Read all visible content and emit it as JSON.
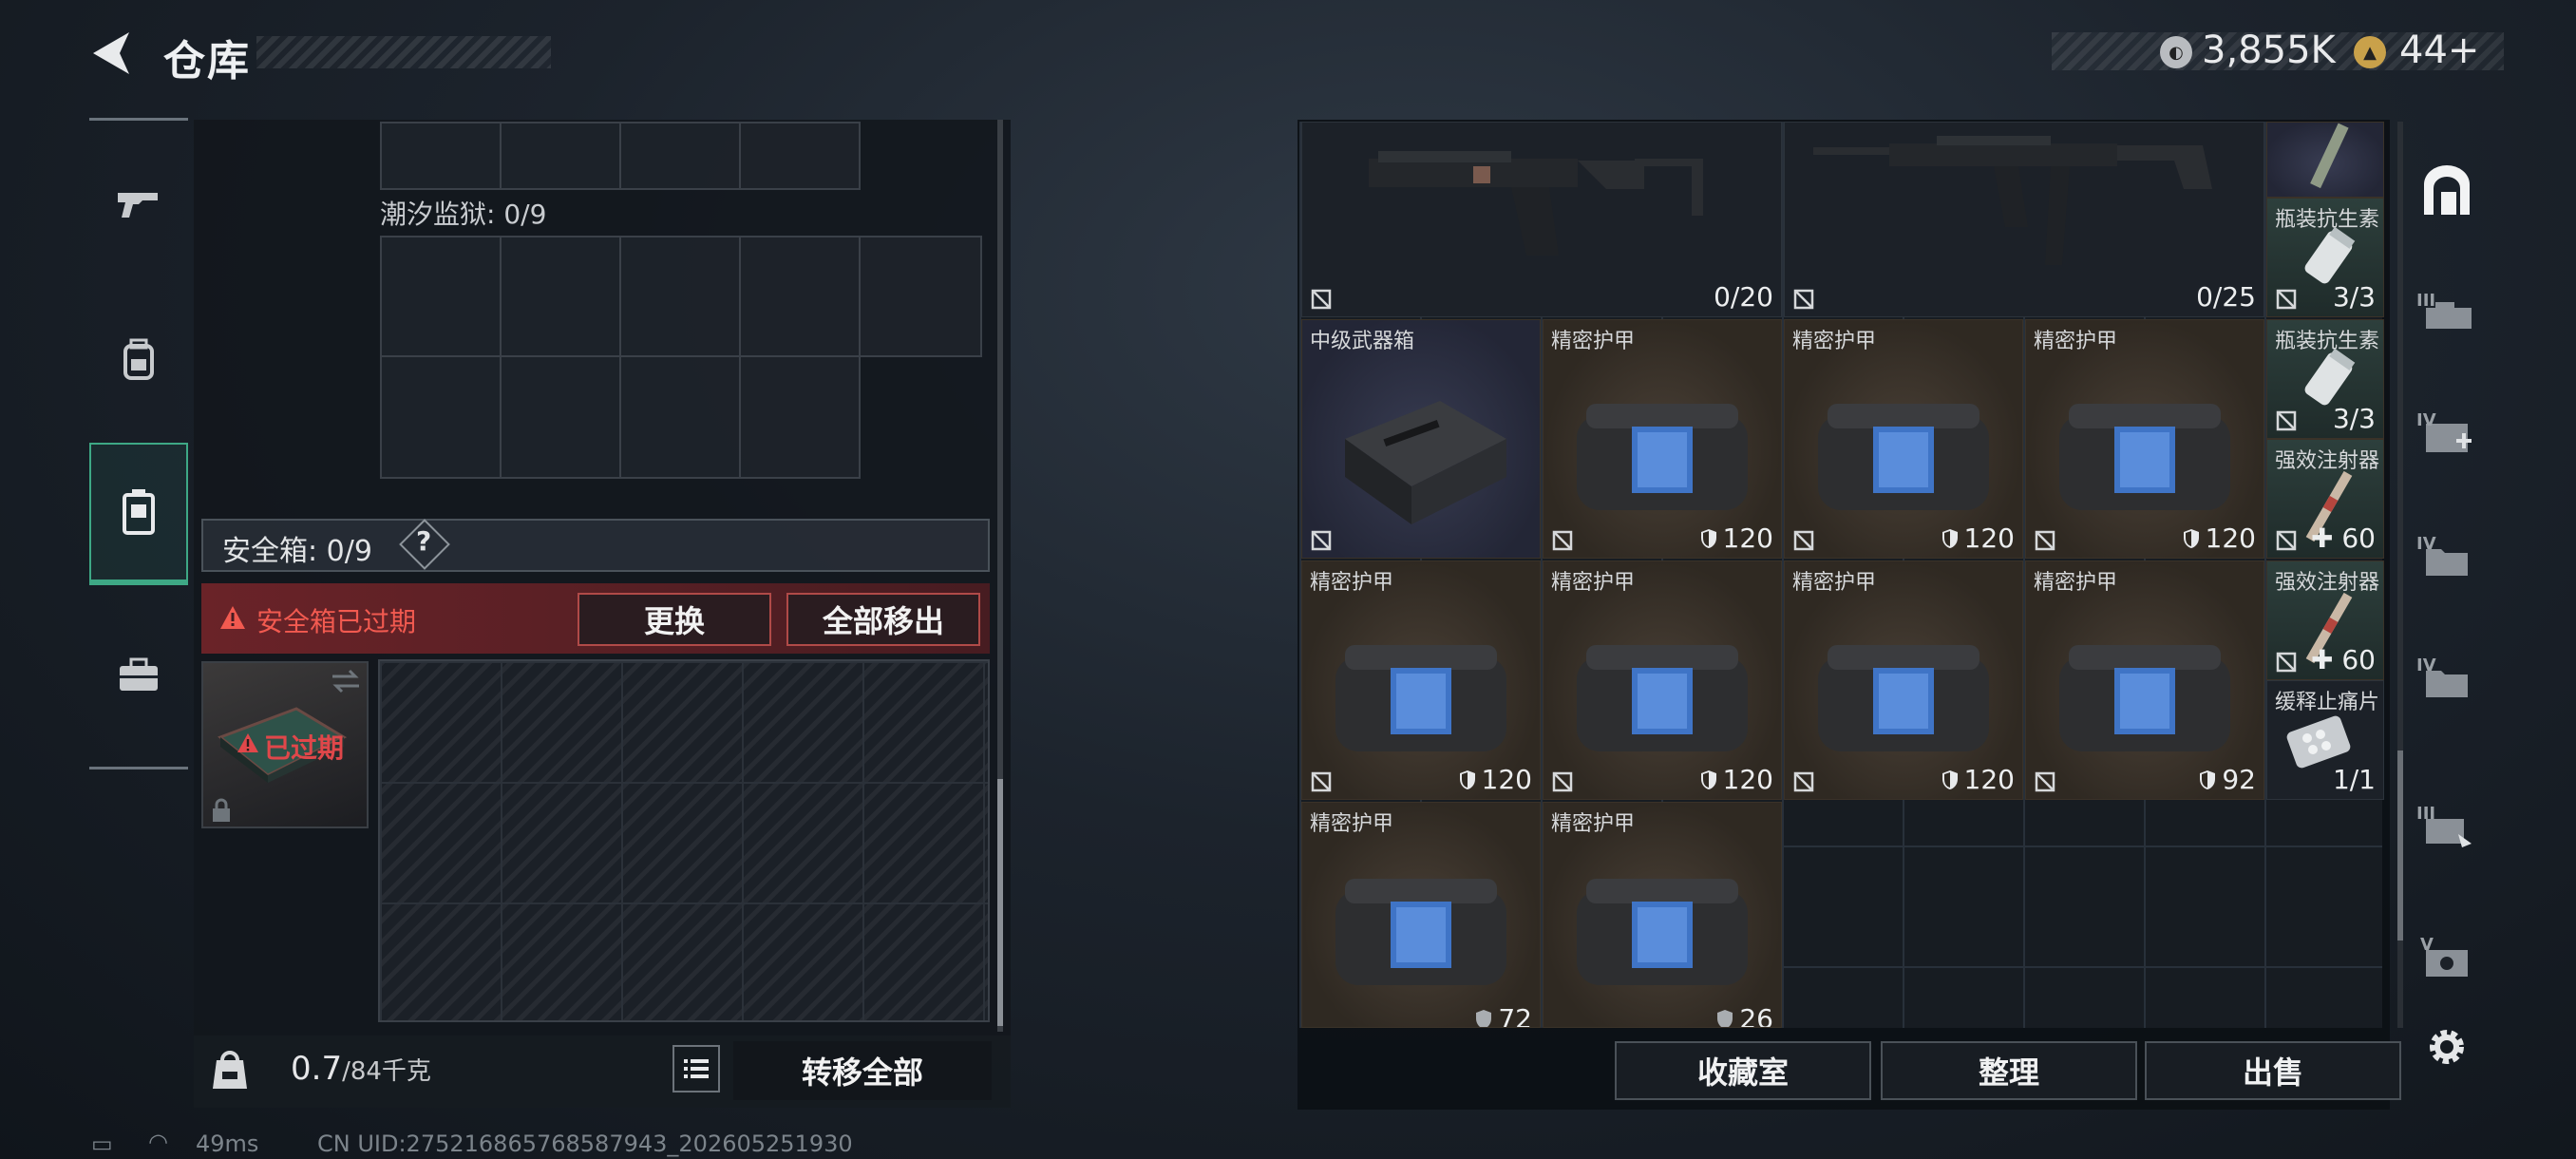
{
  "header": {
    "title": "仓库",
    "currency_silver": "3,855K",
    "currency_gold": "44+"
  },
  "nav": {
    "items": [
      {
        "name": "weapon",
        "icon": "gun-icon"
      },
      {
        "name": "backpack",
        "icon": "backpack-icon"
      },
      {
        "name": "safe-case",
        "icon": "case-icon",
        "active": true
      },
      {
        "name": "toolbox",
        "icon": "toolbox-icon"
      }
    ]
  },
  "left": {
    "tide_prison_label": "潮汐监狱: 0/9",
    "safe_box_label": "安全箱: 0/9",
    "help_label": "?",
    "expired_warning": "安全箱已过期",
    "swap_button": "更换",
    "move_all_out_button": "全部移出",
    "case_expired_label": "已过期",
    "weight_value": "0.7",
    "weight_max": "/84千克",
    "transfer_all_button": "转移全部"
  },
  "status_bar": {
    "ping": "49ms",
    "uid": "CN UID:2752168657685879​43_202605251930"
  },
  "inventory": {
    "weapons": [
      {
        "count": "0/20"
      },
      {
        "count": "0/25"
      }
    ],
    "side_items": [
      {
        "name": "瓶装抗生素",
        "count": "3/3"
      },
      {
        "name": "瓶装抗生素",
        "count": "3/3"
      },
      {
        "name": "强效注射器",
        "count": "60"
      },
      {
        "name": "强效注射器",
        "count": "60"
      },
      {
        "name": "缓释止痛片",
        "count": "1/1"
      }
    ],
    "grid_items": [
      {
        "name": "中级武器箱",
        "count": ""
      },
      {
        "name": "精密护甲",
        "count": "120"
      },
      {
        "name": "精密护甲",
        "count": "120"
      },
      {
        "name": "精密护甲",
        "count": "120"
      },
      {
        "name": "精密护甲",
        "count": "120"
      },
      {
        "name": "精密护甲",
        "count": "120"
      },
      {
        "name": "精密护甲",
        "count": "120"
      },
      {
        "name": "精密护甲",
        "count": "92"
      },
      {
        "name": "精密护甲",
        "count": "72"
      },
      {
        "name": "精密护甲",
        "count": "26"
      }
    ]
  },
  "right_footer": {
    "collection_button": "收藏室",
    "organize_button": "整理",
    "sell_button": "出售"
  },
  "right_side": {
    "labels": [
      "III",
      "IV",
      "IV",
      "IV",
      "III",
      "V"
    ]
  }
}
